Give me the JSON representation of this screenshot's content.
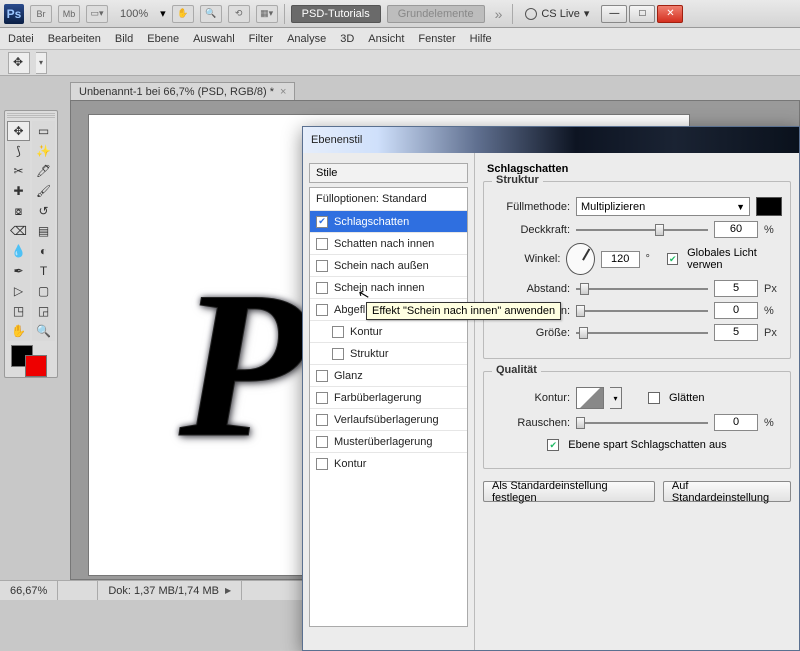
{
  "topbar": {
    "zoom": "100%",
    "tab_tutorials": "PSD-Tutorials",
    "tab_grundelemente": "Grundelemente",
    "cslive": "CS Live"
  },
  "menus": [
    "Datei",
    "Bearbeiten",
    "Bild",
    "Ebene",
    "Auswahl",
    "Filter",
    "Analyse",
    "3D",
    "Ansicht",
    "Fenster",
    "Hilfe"
  ],
  "doc_tab": "Unbenannt-1 bei 66,7% (PSD, RGB/8) *",
  "status": {
    "zoom": "66,67%",
    "doc": "Dok: 1,37 MB/1,74 MB"
  },
  "dialog": {
    "title": "Ebenenstil",
    "styles_header": "Stile",
    "items": [
      {
        "label": "Fülloptionen: Standard",
        "checked": false,
        "nochk": true
      },
      {
        "label": "Schlagschatten",
        "checked": true,
        "selected": true
      },
      {
        "label": "Schatten nach innen",
        "checked": false
      },
      {
        "label": "Schein nach außen",
        "checked": false
      },
      {
        "label": "Schein nach innen",
        "checked": false
      },
      {
        "label": "Abgefl",
        "checked": false
      },
      {
        "label": "Kontur",
        "checked": false,
        "indent": true
      },
      {
        "label": "Struktur",
        "checked": false,
        "indent": true
      },
      {
        "label": "Glanz",
        "checked": false
      },
      {
        "label": "Farbüberlagerung",
        "checked": false
      },
      {
        "label": "Verlaufsüberlagerung",
        "checked": false
      },
      {
        "label": "Musterüberlagerung",
        "checked": false
      },
      {
        "label": "Kontur",
        "checked": false
      }
    ],
    "tooltip": "Effekt \"Schein nach innen\" anwenden",
    "panel_title": "Schlagschatten",
    "group_struktur": "Struktur",
    "labels": {
      "fuellmethode": "Füllmethode:",
      "deckkraft": "Deckkraft:",
      "winkel": "Winkel:",
      "global": "Globales Licht verwen",
      "abstand": "Abstand:",
      "ueberfuellen": "en:",
      "groesse": "Größe:",
      "qualitaet": "Qualität",
      "kontur": "Kontur:",
      "glaetten": "Glätten",
      "rauschen": "Rauschen:",
      "spare": "Ebene spart Schlagschatten aus",
      "btn_std": "Als Standardeinstellung festlegen",
      "btn_reset": "Auf Standardeinstellung"
    },
    "values": {
      "fuellmethode": "Multiplizieren",
      "deckkraft": "60",
      "winkel": "120",
      "abstand": "5",
      "ueberfuellen": "0",
      "groesse": "5",
      "rauschen": "0",
      "pct": "%",
      "deg": "°",
      "px": "Px"
    }
  }
}
